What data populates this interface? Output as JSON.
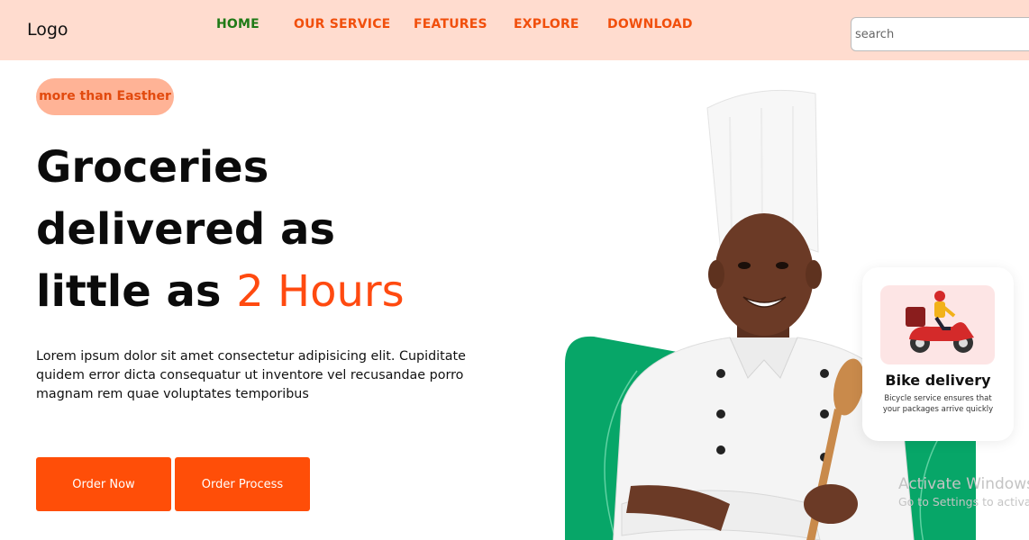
{
  "header": {
    "logo": "Logo",
    "nav": [
      {
        "label": "HOME",
        "active": true
      },
      {
        "label": "OUR SERVICE",
        "active": false
      },
      {
        "label": "FEATURES",
        "active": false
      },
      {
        "label": "EXPLORE",
        "active": false
      },
      {
        "label": "DOWNLOAD",
        "active": false
      }
    ],
    "search_placeholder": "search"
  },
  "hero": {
    "badge": "more than Easther",
    "headline_line1": "Groceries",
    "headline_line2": "delivered as",
    "headline_line3_prefix": "little as ",
    "headline_highlight": "2 Hours",
    "description": "Lorem ipsum dolor sit amet consectetur adipisicing elit. Cupiditate quidem error dicta consequatur ut inventore vel recusandae porro magnam rem quae voluptates temporibus",
    "buttons": {
      "order_now": "Order Now",
      "order_process": "Order Process"
    }
  },
  "card": {
    "icon": "scooter-delivery-icon",
    "title": "Bike delivery",
    "text": "Bicycle service ensures that your packages arrive quickly"
  },
  "watermark": {
    "line1": "Activate Windows",
    "line2": "Go to Settings to activate Windows."
  },
  "colors": {
    "header_bg": "#ffdccf",
    "accent": "#ff4e08",
    "nav_active": "#1f7a16",
    "badge_bg": "#ffb396",
    "green": "#07a668"
  }
}
